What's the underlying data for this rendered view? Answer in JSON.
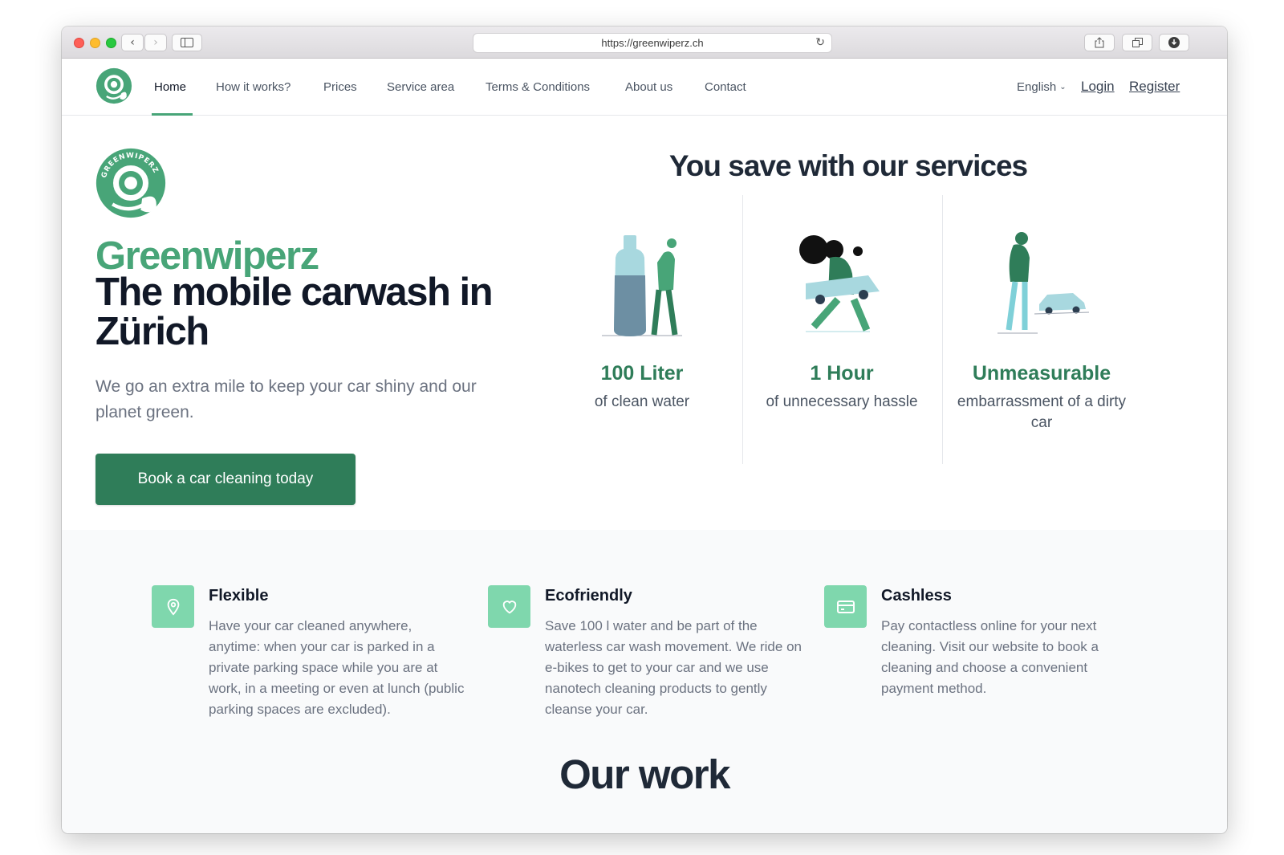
{
  "browser": {
    "url": "https://greenwiperz.ch"
  },
  "nav": {
    "links": [
      "Home",
      "How it works?",
      "Prices",
      "Service area",
      "Terms & Conditions",
      "About us",
      "Contact"
    ],
    "language": "English",
    "login": "Login",
    "register": "Register"
  },
  "hero": {
    "brand": "Greenwiperz",
    "tagline": "The mobile carwash in Zürich",
    "lead": "We go an extra mile to keep your car shiny and our planet green.",
    "cta": "Book a car cleaning today"
  },
  "savings": {
    "heading": "You save with our services",
    "stats": [
      {
        "title": "100 Liter",
        "subtitle": "of clean water",
        "icon": "water-bottle-illustration"
      },
      {
        "title": "1 Hour",
        "subtitle": "of unnecessary hassle",
        "icon": "person-carrying-car-illustration"
      },
      {
        "title": "Unmeasurable",
        "subtitle": "embarrassment of a dirty car",
        "icon": "person-with-car-illustration"
      }
    ]
  },
  "features": [
    {
      "title": "Flexible",
      "icon": "location-pin-icon",
      "text": "Have your car cleaned anywhere, anytime: when your car is parked in a private parking space while you are at work, in a meeting or even at lunch (public parking spaces are excluded)."
    },
    {
      "title": "Ecofriendly",
      "icon": "heart-icon",
      "text": "Save 100 l water and be part of the waterless car wash movement. We ride on e-bikes to get to your car and we use nanotech cleaning products to gently cleanse your car."
    },
    {
      "title": "Cashless",
      "icon": "credit-card-icon",
      "text": "Pay contactless online for your next cleaning. Visit our website to book a cleaning and choose a convenient payment method."
    }
  ],
  "our_work": {
    "heading": "Our work"
  },
  "colors": {
    "brand_green": "#48a578",
    "button_green": "#2f7d59",
    "icon_bg": "#7fd7ad"
  }
}
